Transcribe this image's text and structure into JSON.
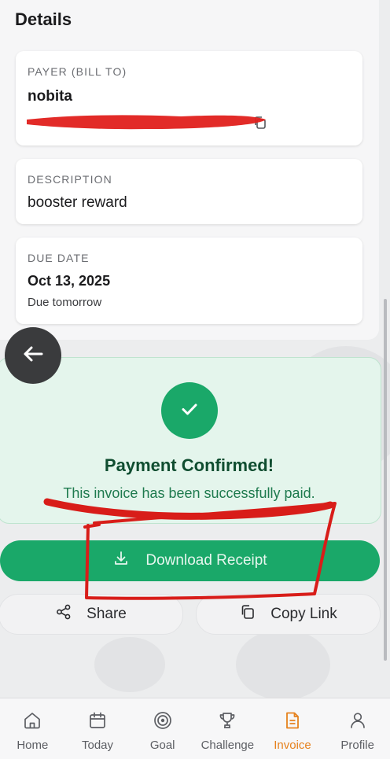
{
  "details": {
    "section_title": "Details",
    "payer": {
      "label": "PAYER (BILL TO)",
      "name": "nobita"
    },
    "description": {
      "label": "DESCRIPTION",
      "value": "booster reward"
    },
    "due_date": {
      "label": "DUE DATE",
      "value": "Oct 13, 2025",
      "note": "Due tomorrow"
    }
  },
  "confirmation": {
    "title": "Payment Confirmed!",
    "message": "This invoice has been successfully paid.",
    "accent_color": "#1aa869"
  },
  "actions": {
    "download_label": "Download Receipt",
    "share_label": "Share",
    "copy_label": "Copy Link"
  },
  "bottom_nav": {
    "items": [
      {
        "label": "Home",
        "icon": "home-icon",
        "active": false
      },
      {
        "label": "Today",
        "icon": "calendar-icon",
        "active": false
      },
      {
        "label": "Goal",
        "icon": "target-icon",
        "active": false
      },
      {
        "label": "Challenge",
        "icon": "trophy-icon",
        "active": false
      },
      {
        "label": "Invoice",
        "icon": "document-icon",
        "active": true
      },
      {
        "label": "Profile",
        "icon": "user-icon",
        "active": false
      }
    ],
    "active_color": "#e6821e"
  }
}
